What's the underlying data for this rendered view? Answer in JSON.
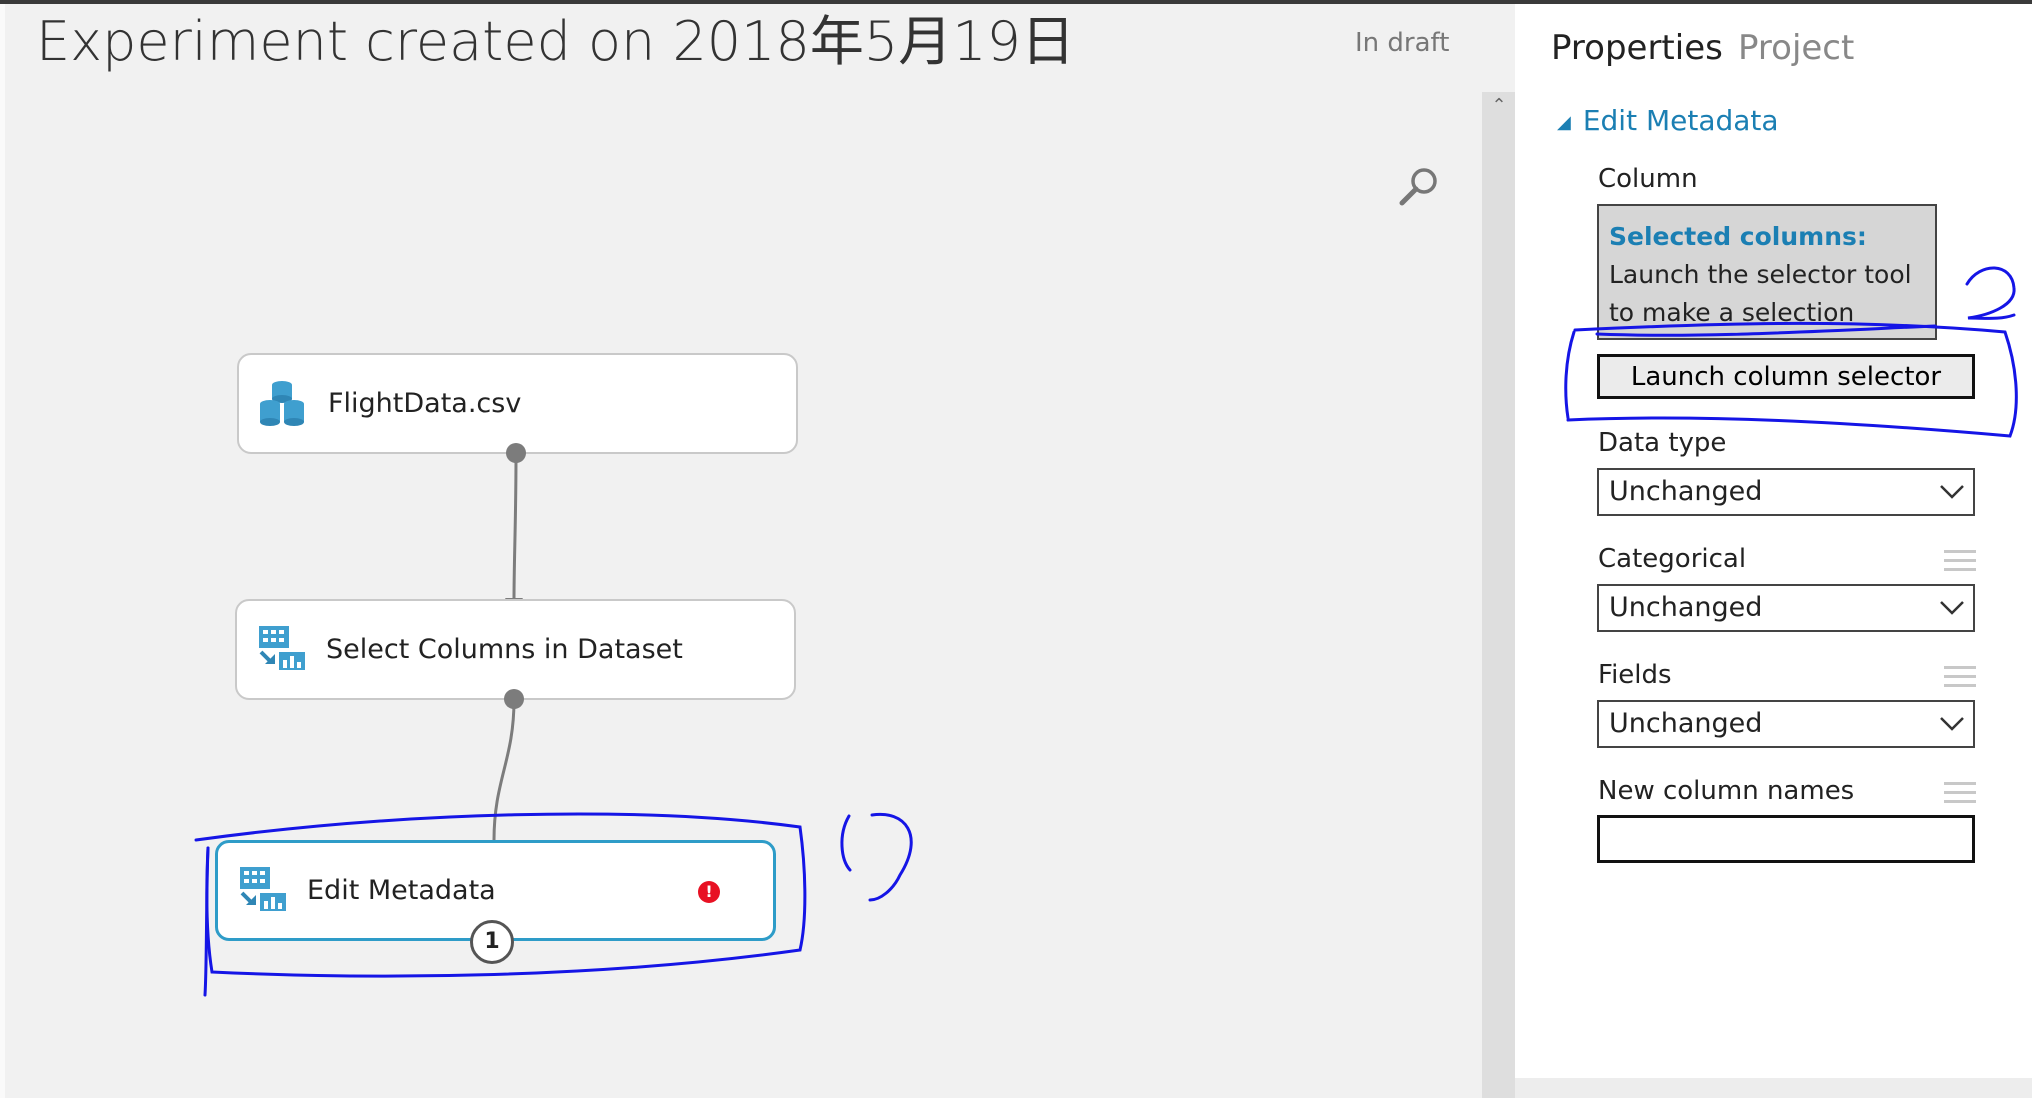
{
  "experiment": {
    "title": "Experiment created on 2018年5月19日",
    "status": "In draft"
  },
  "canvas": {
    "modules": [
      {
        "label": "FlightData.csv",
        "icon": "dataset-icon"
      },
      {
        "label": "Select Columns in Dataset",
        "icon": "select-columns-icon"
      },
      {
        "label": "Edit Metadata",
        "icon": "edit-metadata-icon",
        "error": "!",
        "badge": "1"
      }
    ]
  },
  "properties": {
    "tabs": [
      "Properties",
      "Project"
    ],
    "section": "Edit Metadata",
    "column": {
      "label": "Column",
      "selected_title": "Selected columns:",
      "selected_text": "Launch the selector tool to make a selection",
      "launch_button": "Launch column selector"
    },
    "data_type": {
      "label": "Data type",
      "value": "Unchanged"
    },
    "categorical": {
      "label": "Categorical",
      "value": "Unchanged"
    },
    "fields": {
      "label": "Fields",
      "value": "Unchanged"
    },
    "new_column_names": {
      "label": "New column names",
      "value": ""
    }
  },
  "colors": {
    "accent": "#1b7fb3",
    "selection": "#2e9cc8",
    "error": "#e81123",
    "annotation": "#1515e6"
  }
}
